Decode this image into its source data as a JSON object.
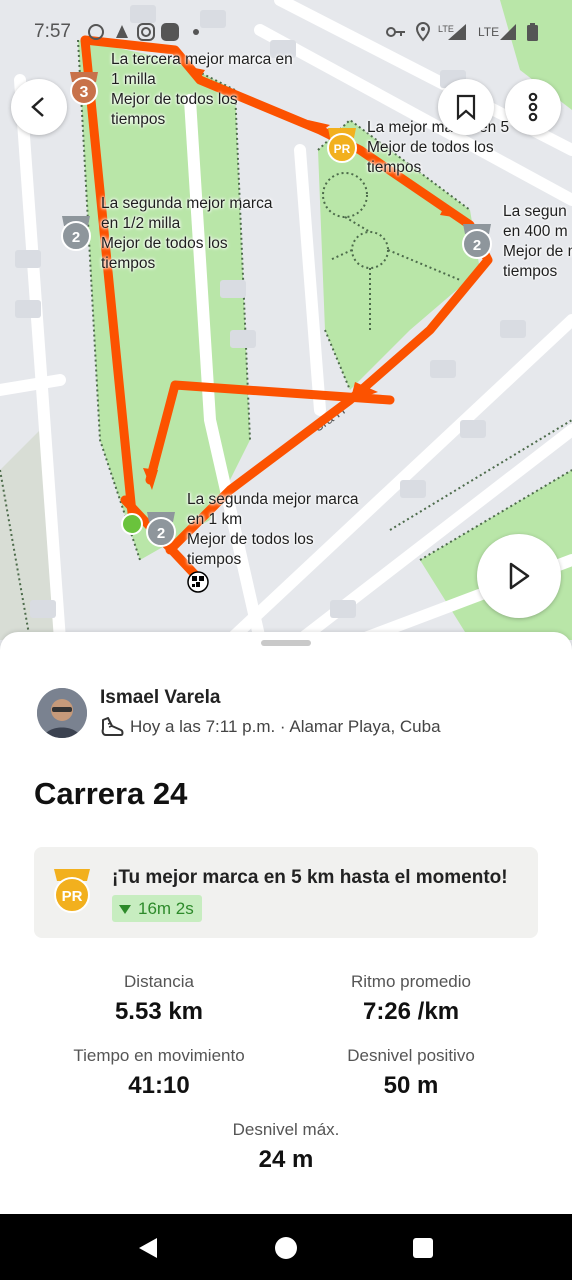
{
  "status_bar": {
    "time": "7:57"
  },
  "map": {
    "road_label": "3ra H",
    "labels": [
      {
        "id": "pr-third-mile",
        "lines": [
          "La tercera mejor marca en",
          "1 milla",
          "Mejor de todos los",
          "tiempos"
        ]
      },
      {
        "id": "pr-5",
        "lines": [
          "La mejor marca en 5",
          "Mejor de todos los",
          "tiempos"
        ]
      },
      {
        "id": "pr-half-mile",
        "lines": [
          "La segunda mejor marca",
          "en 1/2 milla",
          "Mejor de todos los",
          "tiempos"
        ]
      },
      {
        "id": "pr-400",
        "lines": [
          "La segun",
          "en 400 m",
          "Mejor de m",
          "tiempos"
        ]
      },
      {
        "id": "pr-1km",
        "lines": [
          "La segunda mejor marca",
          "en 1 km",
          "Mejor de todos los",
          "tiempos"
        ]
      }
    ],
    "medals": [
      {
        "id": "medal-3",
        "text": "3",
        "color": "#c8724a"
      },
      {
        "id": "medal-pr",
        "text": "PR",
        "color": "#f2b01e"
      },
      {
        "id": "medal-2a",
        "text": "2",
        "color": "#8e969c"
      },
      {
        "id": "medal-2b",
        "text": "2",
        "color": "#8e969c"
      },
      {
        "id": "medal-2c",
        "text": "2",
        "color": "#8e969c"
      }
    ],
    "route_color": "#fc5200"
  },
  "activity": {
    "athlete_name": "Ismael Varela",
    "meta": "Hoy a las 7:11 p.m. · Alamar Playa, Cuba",
    "title": "Carrera 24",
    "pr_message": "¡Tu mejor marca en 5 km hasta el momento!",
    "pr_improvement": "16m 2s",
    "stats": [
      {
        "label": "Distancia",
        "value": "5.53 km"
      },
      {
        "label": "Ritmo promedio",
        "value": "7:26 /km"
      },
      {
        "label": "Tiempo en movimiento",
        "value": "41:10"
      },
      {
        "label": "Desnivel positivo",
        "value": "50 m"
      },
      {
        "label": "Desnivel máx.",
        "value": "24 m"
      }
    ]
  }
}
